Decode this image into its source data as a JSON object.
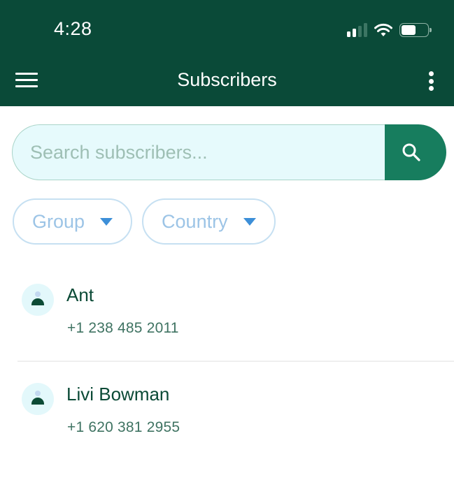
{
  "status_bar": {
    "time": "4:28",
    "signal_bars_active": 2,
    "signal_bars_total": 4,
    "battery_level_percent": 55,
    "icons": [
      "signal-icon",
      "wifi-icon",
      "battery-icon"
    ]
  },
  "app_bar": {
    "title": "Subscribers",
    "menu_icon": "hamburger-menu-icon",
    "more_icon": "more-vertical-icon",
    "background_color": "#0a4a38"
  },
  "search": {
    "placeholder": "Search subscribers...",
    "value": "",
    "button_icon": "search-icon",
    "button_color": "#177d5e"
  },
  "filters": [
    {
      "label": "Group",
      "icon": "dropdown-arrow-icon"
    },
    {
      "label": "Country",
      "icon": "dropdown-arrow-icon"
    }
  ],
  "subscribers": [
    {
      "name": "Ant",
      "phone": "+1 238 485 2011",
      "avatar_icon": "person-icon"
    },
    {
      "name": "Livi Bowman",
      "phone": "+1 620 381 2955",
      "avatar_icon": "person-icon"
    }
  ]
}
